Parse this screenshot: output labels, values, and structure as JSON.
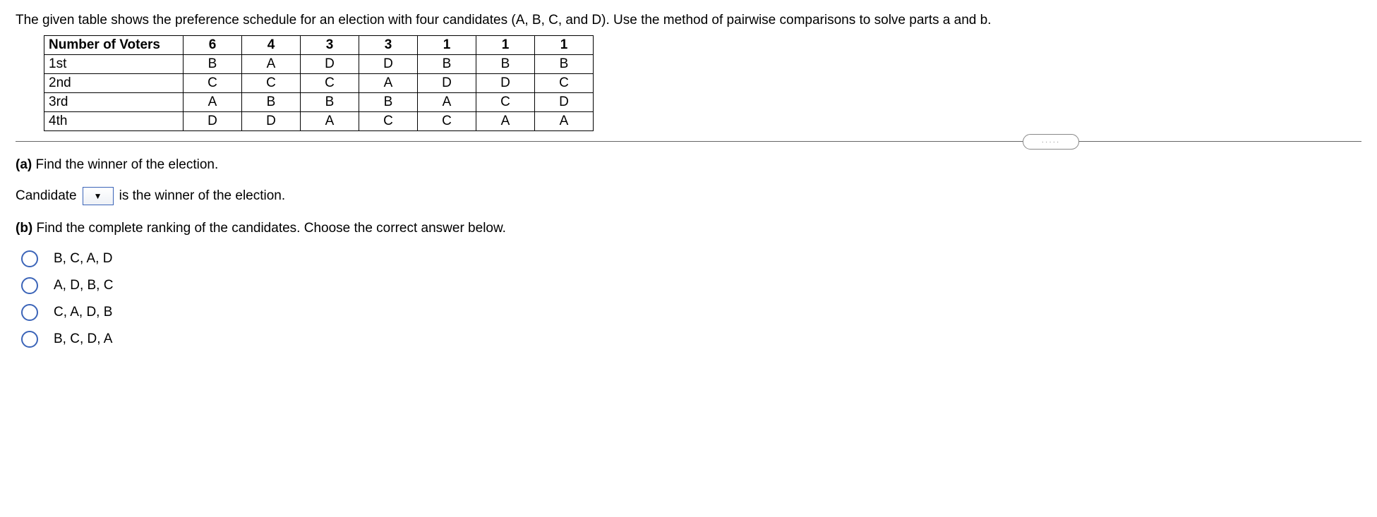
{
  "intro": "The given table shows the preference schedule for an election with four candidates (A, B, C, and D). Use the method of pairwise comparisons to solve parts a and b.",
  "table": {
    "header_label": "Number of Voters",
    "voter_counts": [
      "6",
      "4",
      "3",
      "3",
      "1",
      "1",
      "1"
    ],
    "rows": [
      {
        "label": "1st",
        "values": [
          "B",
          "A",
          "D",
          "D",
          "B",
          "B",
          "B"
        ]
      },
      {
        "label": "2nd",
        "values": [
          "C",
          "C",
          "C",
          "A",
          "D",
          "D",
          "C"
        ]
      },
      {
        "label": "3rd",
        "values": [
          "A",
          "B",
          "B",
          "B",
          "A",
          "C",
          "D"
        ]
      },
      {
        "label": "4th",
        "values": [
          "D",
          "D",
          "A",
          "C",
          "C",
          "A",
          "A"
        ]
      }
    ]
  },
  "pill": "·····",
  "partA": {
    "label": "(a)",
    "text": "Find the winner of the election.",
    "answer_prefix": "Candidate",
    "dropdown_glyph": "▼",
    "answer_suffix": "is the winner of the election."
  },
  "partB": {
    "label": "(b)",
    "text": "Find the complete ranking of the candidates. Choose the correct answer below.",
    "options": [
      "B, C, A, D",
      "A, D, B, C",
      "C, A, D, B",
      "B, C, D, A"
    ]
  }
}
